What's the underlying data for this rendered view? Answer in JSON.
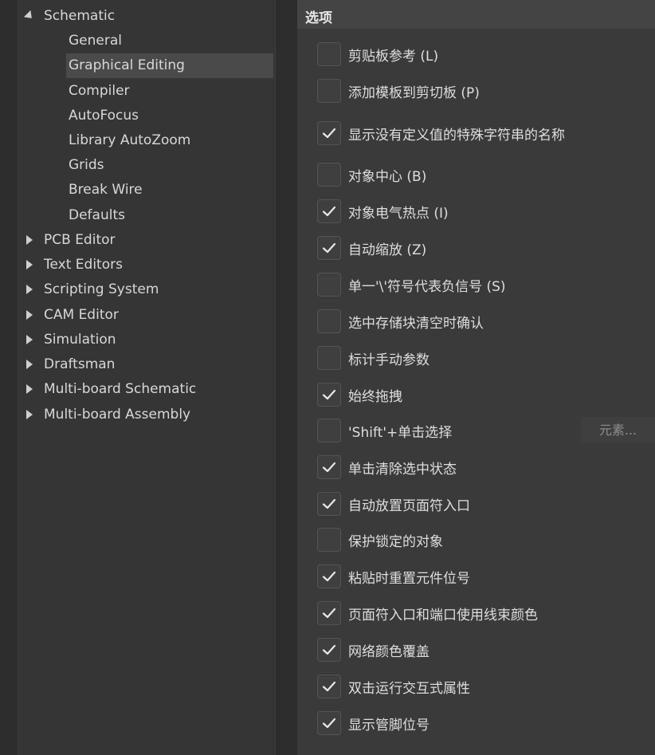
{
  "tree": {
    "items": [
      {
        "label": "Schematic",
        "expanded": true
      },
      {
        "label": "General"
      },
      {
        "label": "Graphical Editing",
        "selected": true
      },
      {
        "label": "Compiler"
      },
      {
        "label": "AutoFocus"
      },
      {
        "label": "Library AutoZoom"
      },
      {
        "label": "Grids"
      },
      {
        "label": "Break Wire"
      },
      {
        "label": "Defaults"
      },
      {
        "label": "PCB Editor",
        "expanded": false
      },
      {
        "label": "Text Editors",
        "expanded": false
      },
      {
        "label": "Scripting System",
        "expanded": false
      },
      {
        "label": "CAM Editor",
        "expanded": false
      },
      {
        "label": "Simulation",
        "expanded": false
      },
      {
        "label": "Draftsman",
        "expanded": false
      },
      {
        "label": "Multi-board Schematic",
        "expanded": false
      },
      {
        "label": "Multi-board Assembly",
        "expanded": false
      }
    ]
  },
  "options": {
    "title": "选项",
    "items": [
      {
        "label": "剪贴板参考 (L)",
        "checked": false
      },
      {
        "label": "添加模板到剪切板 (P)",
        "checked": false
      },
      {
        "label": "显示没有定义值的特殊字符串的名称",
        "checked": true
      },
      {
        "label": "对象中心 (B)",
        "checked": false
      },
      {
        "label": "对象电气热点 (I)",
        "checked": true
      },
      {
        "label": "自动缩放 (Z)",
        "checked": true
      },
      {
        "label": "单一'\\'符号代表负信号 (S)",
        "checked": false
      },
      {
        "label": "选中存储块清空时确认",
        "checked": false
      },
      {
        "label": "标计手动参数",
        "checked": false
      },
      {
        "label": "始终拖拽",
        "checked": true
      },
      {
        "label": "'Shift'+单击选择",
        "checked": false
      },
      {
        "label": "单击清除选中状态",
        "checked": true
      },
      {
        "label": "自动放置页面符入口",
        "checked": true
      },
      {
        "label": "保护锁定的对象",
        "checked": false
      },
      {
        "label": "粘贴时重置元件位号",
        "checked": true
      },
      {
        "label": "页面符入口和端口使用线束颜色",
        "checked": true
      },
      {
        "label": "网络颜色覆盖",
        "checked": true
      },
      {
        "label": "双击运行交互式属性",
        "checked": true
      },
      {
        "label": "显示管脚位号",
        "checked": true
      }
    ],
    "elements_button": "元素..."
  }
}
